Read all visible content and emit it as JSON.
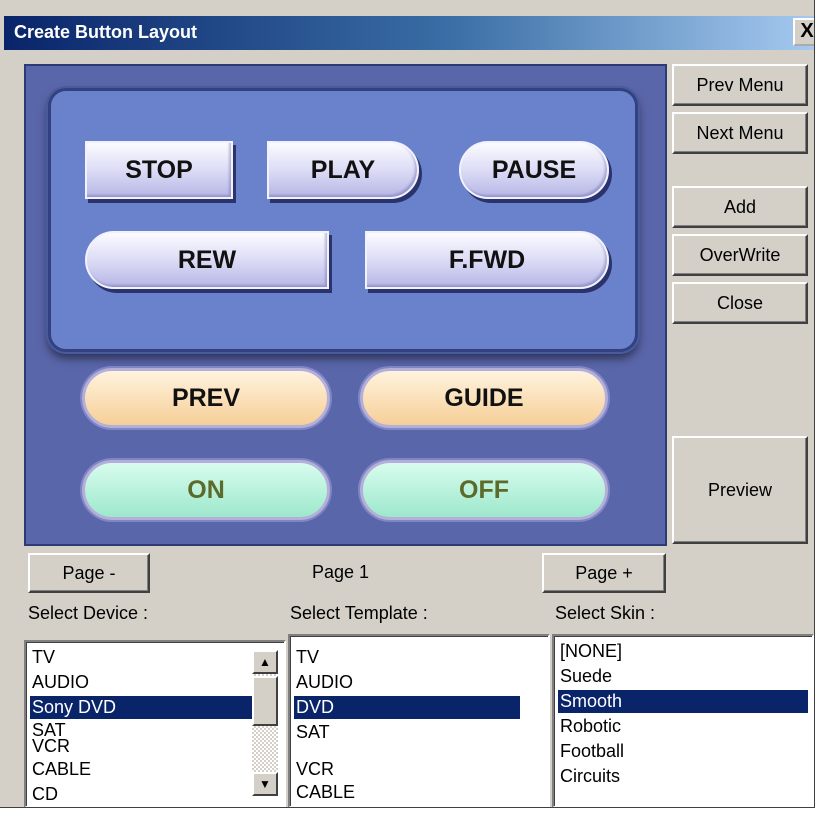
{
  "window": {
    "title": "Create Button Layout",
    "close_label": "X"
  },
  "remote": {
    "stop": "STOP",
    "play": "PLAY",
    "pause": "PAUSE",
    "rew": "REW",
    "ffwd": "F.FWD",
    "prev": "PREV",
    "guide": "GUIDE",
    "on": "ON",
    "off": "OFF"
  },
  "side_buttons": {
    "prev_menu": "Prev Menu",
    "next_menu": "Next Menu",
    "add": "Add",
    "overwrite": "OverWrite",
    "close": "Close",
    "preview": "Preview"
  },
  "pager": {
    "prev": "Page -",
    "label": "Page 1",
    "next": "Page +"
  },
  "labels": {
    "device": "Select Device :",
    "template": "Select Template :",
    "skin": "Select Skin :"
  },
  "devices": [
    "TV",
    "AUDIO",
    "Sony DVD",
    "SAT",
    "VCR",
    "CABLE",
    "CD"
  ],
  "templates": [
    "TV",
    "AUDIO",
    "DVD",
    "SAT",
    "VCR",
    "CABLE"
  ],
  "skins": [
    "[NONE]",
    "Suede",
    "Smooth",
    "Robotic",
    "Football",
    "Circuits"
  ],
  "colors": {
    "selection": "#0a246a",
    "panel": "#5a66aa",
    "inner_panel": "#6a82cc"
  }
}
